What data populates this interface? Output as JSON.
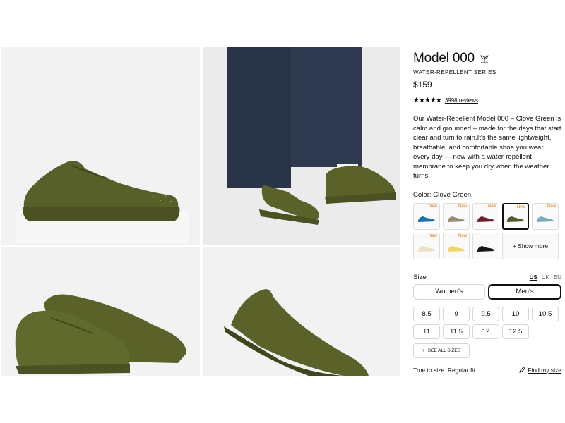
{
  "product": {
    "title": "Model 000",
    "series": "WATER-REPELLENT SERIES",
    "price": "$159",
    "rating_stars": 4.5,
    "reviews": "3998 reviews",
    "description": "Our Water-Repellent Model 000 – Clove Green is calm and grounded – made for the days that start clear and turn to rain.It's the same lightweight, breathable, and comfortable shoe you wear every day — now with a water-repellent membrane to keep you dry when the weather turns.",
    "color_label": "Color: Clove Green"
  },
  "swatches": [
    {
      "color": "#1e6fb0",
      "badge": "New"
    },
    {
      "color": "#9a8a72",
      "badge": "New"
    },
    {
      "color": "#6e1f2c",
      "badge": "New"
    },
    {
      "color": "#4f5a2a",
      "badge": "New",
      "selected": true
    },
    {
      "color": "#7fa9bd",
      "badge": "New"
    },
    {
      "color": "#ece0c6",
      "badge": "New"
    },
    {
      "color": "#f2d66a",
      "badge": "New"
    },
    {
      "color": "#161616",
      "badge": ""
    }
  ],
  "show_more_label": "+ Show more",
  "size": {
    "label": "Size",
    "units": [
      "US",
      "UK",
      "EU"
    ],
    "genders": [
      "Women's",
      "Men's"
    ],
    "sizes": [
      "8.5",
      "9",
      "9.5",
      "10",
      "10.5",
      "11",
      "11.5",
      "12",
      "12.5"
    ],
    "see_all": "SEE ALL SIZES",
    "fit_note": "True to size. Regular fit.",
    "find_size": "Find my size"
  }
}
